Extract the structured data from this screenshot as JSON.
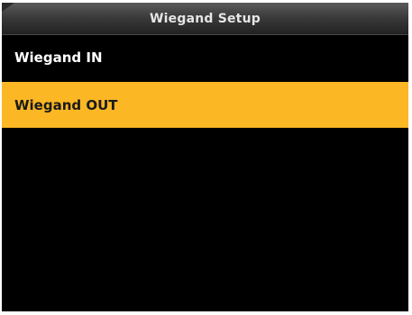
{
  "header": {
    "title": "Wiegand Setup"
  },
  "menu": {
    "items": [
      {
        "label": "Wiegand IN",
        "selected": false
      },
      {
        "label": "Wiegand OUT",
        "selected": true
      }
    ]
  },
  "colors": {
    "screen_background": "#000000",
    "selection_highlight": "#fbb724",
    "title_text": "#e6e6e6",
    "item_text": "#ffffff"
  }
}
